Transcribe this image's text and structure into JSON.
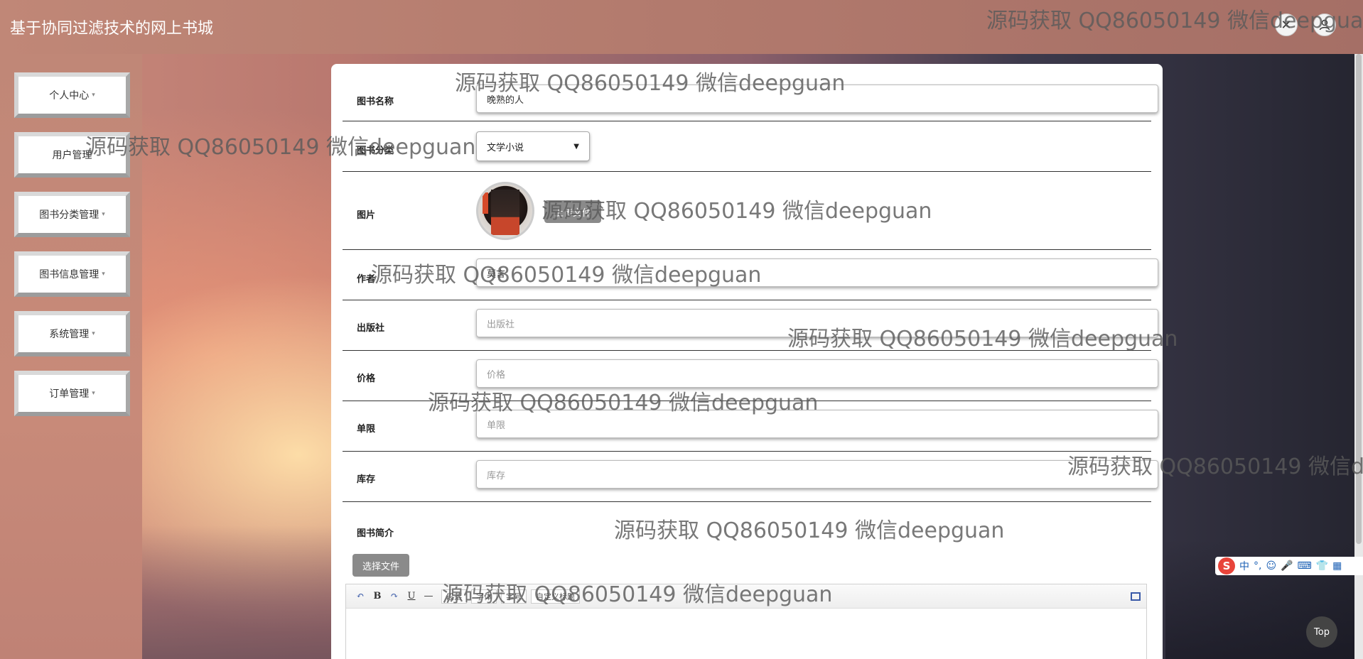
{
  "header": {
    "app_title": "基于协同过滤技术的网上书城"
  },
  "sidebar": {
    "items": [
      {
        "label": "个人中心"
      },
      {
        "label": "用户管理"
      },
      {
        "label": "图书分类管理"
      },
      {
        "label": "图书信息管理"
      },
      {
        "label": "系统管理"
      },
      {
        "label": "订单管理"
      }
    ],
    "caret": "▾"
  },
  "form": {
    "book_name": {
      "label": "图书名称",
      "value": "晚熟的人"
    },
    "category": {
      "label": "图书分类",
      "value": "文学小说"
    },
    "image": {
      "label": "图片",
      "upload_label": "上传文件"
    },
    "author": {
      "label": "作者",
      "value": "莫言"
    },
    "publisher": {
      "label": "出版社",
      "placeholder": "出版社"
    },
    "price": {
      "label": "价格",
      "placeholder": "价格"
    },
    "limit": {
      "label": "单限",
      "placeholder": "单限"
    },
    "stock": {
      "label": "库存",
      "placeholder": "库存"
    },
    "intro": {
      "label": "图书简介",
      "choose_label": "选择文件"
    }
  },
  "editor": {
    "toolbar": {
      "undo_icon": "↶",
      "bold": "B",
      "redo_icon": "↷",
      "underline": "U",
      "hr": "—",
      "heading_select": "段落",
      "font_select": "字体",
      "size_select": "字号",
      "align_select": "自定义标题"
    }
  },
  "top_button": "Top",
  "ime": {
    "logo": "S",
    "mode": "中"
  },
  "watermark": "源码获取 QQ86050149 微信deepguan"
}
